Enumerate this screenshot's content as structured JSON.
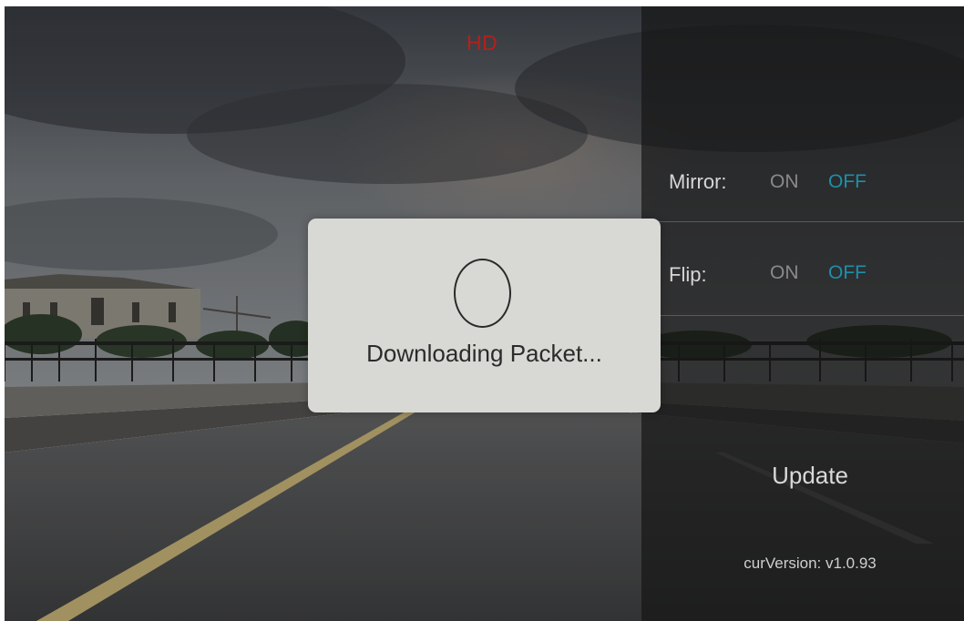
{
  "camera_view": {
    "quality_badge": "HD"
  },
  "settings_panel": {
    "mirror": {
      "label": "Mirror:",
      "on_label": "ON",
      "off_label": "OFF",
      "selected": "OFF"
    },
    "flip": {
      "label": "Flip:",
      "on_label": "ON",
      "off_label": "OFF",
      "selected": "OFF"
    },
    "update_label": "Update",
    "version_text": "curVersion: v1.0.93"
  },
  "dialog": {
    "message": "Downloading Packet...",
    "spinner_icon": "loading-spinner-icon"
  },
  "colors": {
    "badge": "#b3201b",
    "selected_option": "#1f8fa8",
    "unselected_option": "#8a8a8a",
    "dialog_bg": "#d8d8d5"
  }
}
